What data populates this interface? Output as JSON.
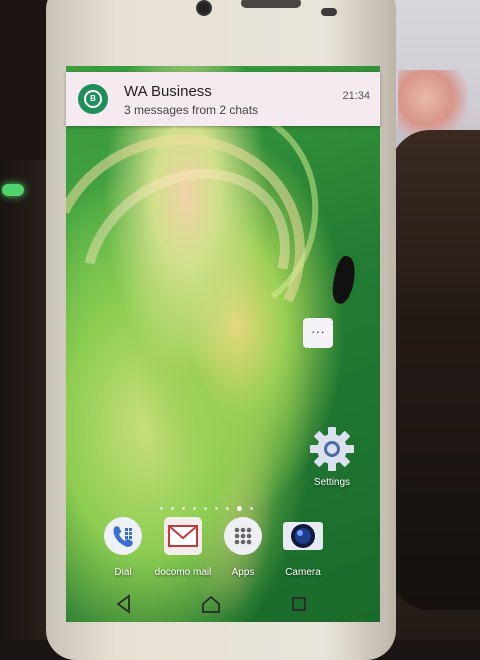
{
  "notification": {
    "app_name": "WA Business",
    "message": "3 messages from 2 chats",
    "time": "21:34",
    "app_icon_letter": "B",
    "icon_color": "#1f8f5a"
  },
  "home": {
    "more_button_label": "···",
    "settings_label": "Settings",
    "page_count": 9,
    "active_page": 8
  },
  "dock": [
    {
      "label": "Dial",
      "icon": "phone-icon"
    },
    {
      "label": "docomo mail",
      "icon": "mail-icon"
    },
    {
      "label": "Apps",
      "icon": "apps-grid-icon"
    },
    {
      "label": "Camera",
      "icon": "camera-icon"
    }
  ],
  "navbar": {
    "back_icon": "back-triangle-icon",
    "home_icon": "home-icon",
    "recents_icon": "recents-square-icon"
  }
}
